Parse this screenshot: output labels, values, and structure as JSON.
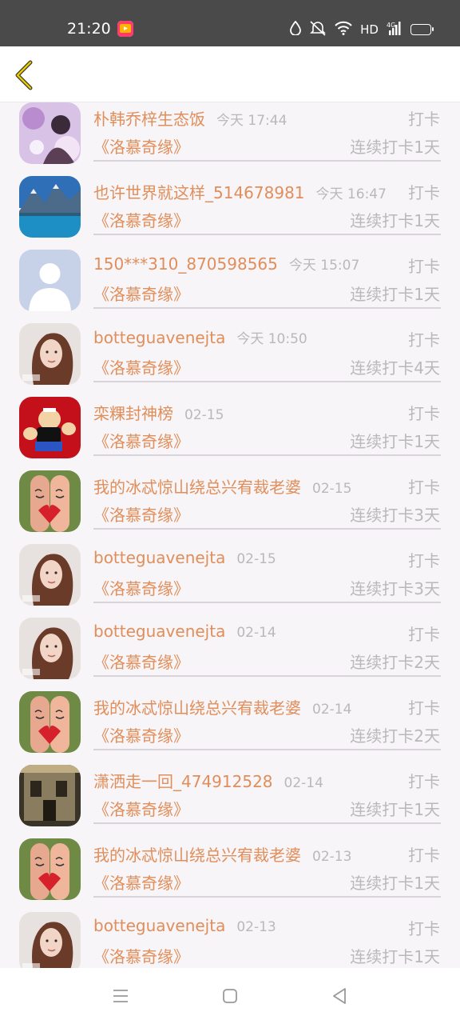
{
  "status_bar": {
    "time": "21:20",
    "network_label": "HD",
    "battery_color": "#f5c518"
  },
  "header": {
    "back_icon": "chevron-left-icon"
  },
  "colors": {
    "accent": "#e08e5b",
    "muted": "#b9b9b9"
  },
  "rows": [
    {
      "name": "朴韩乔梓生态饭",
      "time": "今天 17:44",
      "checkin": "打卡",
      "book": "《洛慕奇缘》",
      "streak": "连续打卡1天",
      "avatar": "woman-flowers"
    },
    {
      "name": "也许世界就这样_514678981",
      "time": "今天 16:47",
      "checkin": "打卡",
      "book": "《洛慕奇缘》",
      "streak": "连续打卡1天",
      "avatar": "mountain-lake"
    },
    {
      "name": "150***310_870598565",
      "time": "今天 15:07",
      "checkin": "打卡",
      "book": "《洛慕奇缘》",
      "streak": "连续打卡1天",
      "avatar": "default-person"
    },
    {
      "name": "botteguavenejta",
      "time": "今天 10:50",
      "checkin": "打卡",
      "book": "《洛慕奇缘》",
      "streak": "连续打卡4天",
      "avatar": "woman-portrait"
    },
    {
      "name": "栾粿封神榜",
      "time": "02-15",
      "checkin": "打卡",
      "book": "《洛慕奇缘》",
      "streak": "连续打卡1天",
      "avatar": "popeye"
    },
    {
      "name": "我的冰忒惊山绕总兴宥裁老婆",
      "time": "02-15",
      "checkin": "打卡",
      "book": "《洛慕奇缘》",
      "streak": "连续打卡3天",
      "avatar": "finger-couple"
    },
    {
      "name": "botteguavenejta",
      "time": "02-15",
      "checkin": "打卡",
      "book": "《洛慕奇缘》",
      "streak": "连续打卡3天",
      "avatar": "woman-portrait"
    },
    {
      "name": "botteguavenejta",
      "time": "02-14",
      "checkin": "打卡",
      "book": "《洛慕奇缘》",
      "streak": "连续打卡2天",
      "avatar": "woman-portrait"
    },
    {
      "name": "我的冰忒惊山绕总兴宥裁老婆",
      "time": "02-14",
      "checkin": "打卡",
      "book": "《洛慕奇缘》",
      "streak": "连续打卡2天",
      "avatar": "finger-couple"
    },
    {
      "name": "潇洒走一回_474912528",
      "time": "02-14",
      "checkin": "打卡",
      "book": "《洛慕奇缘》",
      "streak": "连续打卡1天",
      "avatar": "old-building"
    },
    {
      "name": "我的冰忒惊山绕总兴宥裁老婆",
      "time": "02-13",
      "checkin": "打卡",
      "book": "《洛慕奇缘》",
      "streak": "连续打卡1天",
      "avatar": "finger-couple"
    },
    {
      "name": "botteguavenejta",
      "time": "02-13",
      "checkin": "打卡",
      "book": "《洛慕奇缘》",
      "streak": "连续打卡1天",
      "avatar": "woman-portrait"
    }
  ],
  "nav_bar": {
    "icons": [
      "menu-icon",
      "home-square-icon",
      "back-triangle-icon"
    ]
  }
}
